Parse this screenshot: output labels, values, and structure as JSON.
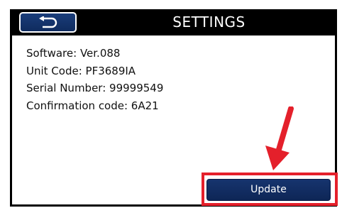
{
  "header": {
    "title": "SETTINGS",
    "back_icon": "return-arrow-icon"
  },
  "info": {
    "software": "Software: Ver.088",
    "unit_code": "Unit Code: PF3689IA",
    "serial_number": "Serial Number: 99999549",
    "confirmation_code": "Confirmation code: 6A21"
  },
  "actions": {
    "update_label": "Update"
  },
  "annotation": {
    "highlight_color": "#e4202b",
    "pointer_icon": "red-arrow-icon"
  },
  "colors": {
    "header_background": "#000000",
    "button_blue": "#16346e",
    "screen_background": "#ffffff"
  }
}
